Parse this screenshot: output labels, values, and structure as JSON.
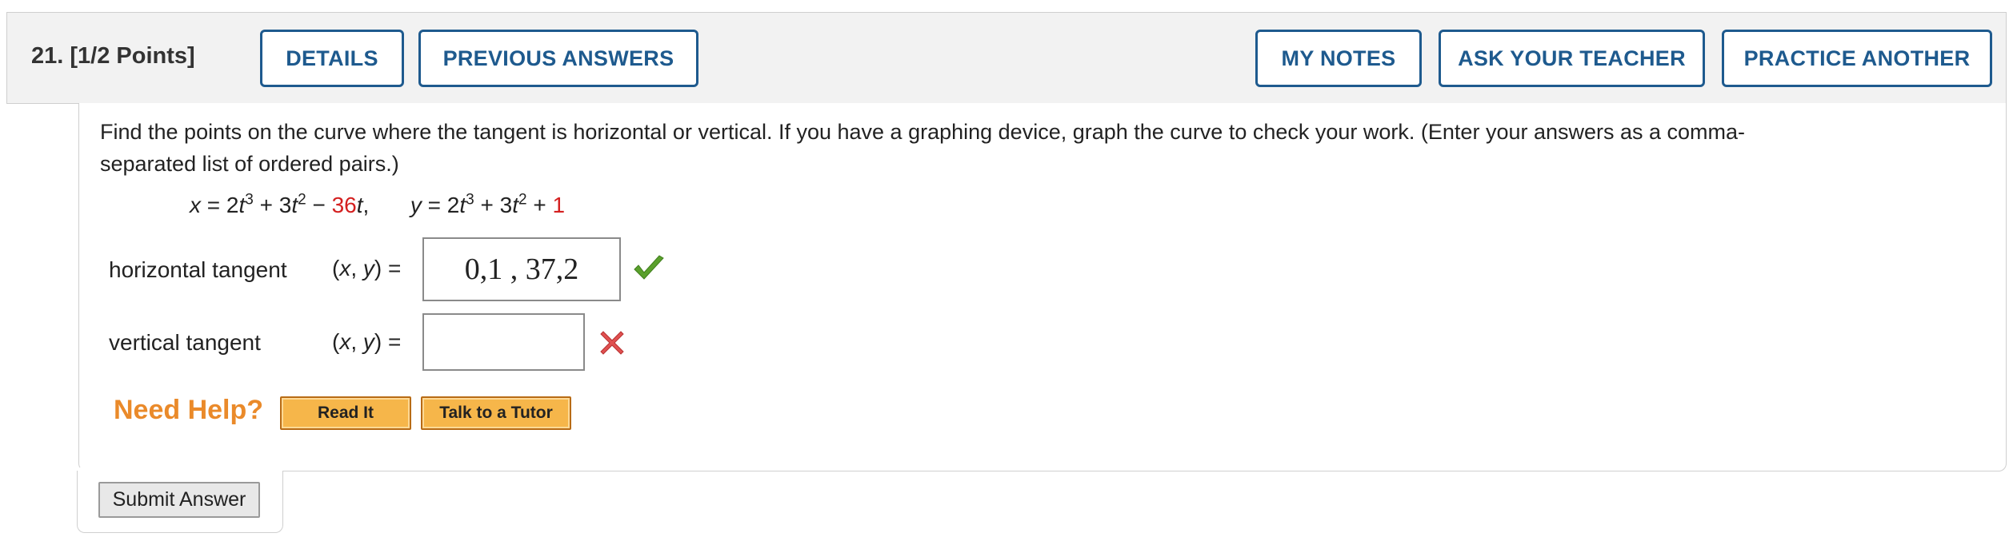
{
  "question": {
    "number": "21.",
    "points": "[1/2 Points]"
  },
  "header_buttons": {
    "details": "DETAILS",
    "previous_answers": "PREVIOUS ANSWERS",
    "my_notes": "MY NOTES",
    "ask_teacher": "ASK YOUR TEACHER",
    "practice_another": "PRACTICE ANOTHER"
  },
  "prompt": {
    "line1": "Find the points on the curve where the tangent is horizontal or vertical. If you have a graphing device, graph the curve to check your work. (Enter your answers as a comma-",
    "line2": "separated list of ordered pairs.)"
  },
  "equation": {
    "x_part1": "x = 2t",
    "x_exp1": "3",
    "x_part2": " + 3t",
    "x_exp2": "2",
    "x_part3": " − ",
    "x_coef": "36",
    "x_part4": "t,",
    "y_part1": "y = 2t",
    "y_exp1": "3",
    "y_part2": " + 3t",
    "y_exp2": "2",
    "y_part3": " + ",
    "y_const": "1"
  },
  "answers": {
    "horizontal": {
      "label": "horizontal tangent",
      "xy_label": "(x, y) =",
      "value": "0,1  ,  37,2",
      "status": "correct",
      "status_icon": "checkmark-icon"
    },
    "vertical": {
      "label": "vertical tangent",
      "xy_label": "(x, y) =",
      "value": "",
      "status": "incorrect",
      "status_icon": "cross-icon"
    }
  },
  "help": {
    "label": "Need Help?",
    "read_it": "Read It",
    "talk_to_tutor": "Talk to a Tutor"
  },
  "submit": {
    "label": "Submit Answer"
  },
  "colors": {
    "accent_blue": "#1e5a8e",
    "highlight_red": "#d42020",
    "need_help_orange": "#ea8a2a",
    "help_button_fill": "#f6b64a",
    "correct_green": "#5aa02c",
    "incorrect_red": "#e05050"
  }
}
